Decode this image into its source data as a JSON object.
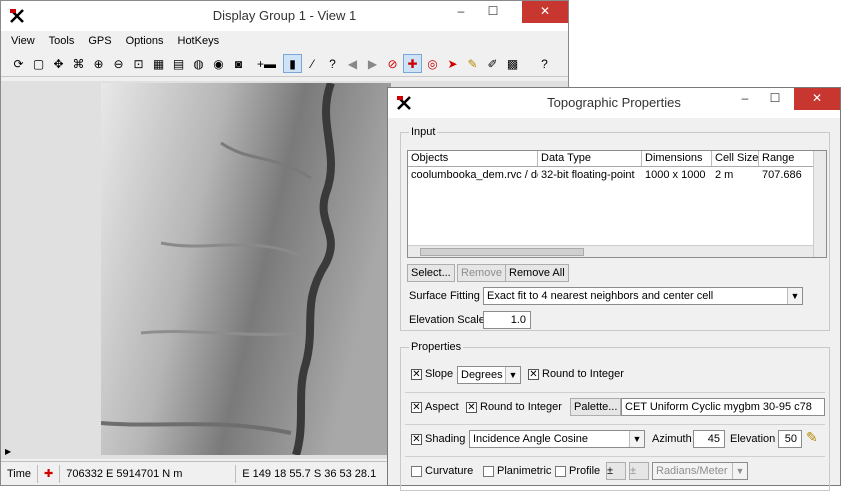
{
  "display_window": {
    "title": "Display Group 1 - View 1",
    "menu": [
      "View",
      "Tools",
      "GPS",
      "Options",
      "HotKeys"
    ],
    "toolbar_icons": [
      "redraw-icon",
      "full-view-icon",
      "pan-icon",
      "binoculars-icon",
      "zoom-in-icon",
      "zoom-out-icon",
      "zoom-box-icon",
      "grid-icon",
      "layer-icon",
      "globe-icon",
      "globe2-icon",
      "camera-icon",
      "add-layer-icon",
      "select-icon",
      "measure-icon",
      "help-cursor-icon",
      "back-icon",
      "forward-icon",
      "cancel-icon",
      "move-icon",
      "zoom-tool-icon",
      "select-arrow-icon",
      "sketch-icon",
      "edit-icon",
      "chart-icon",
      "help-icon"
    ],
    "controls": {
      "minimize": "–",
      "maximize": "☐",
      "close": "✕"
    },
    "status": {
      "time_label": "Time",
      "coords_en": "706332 E  5914701 N m",
      "coords_latlon": "E 149 18 55.7  S 36 53 28.1"
    }
  },
  "topo_window": {
    "title": "Topographic Properties",
    "controls": {
      "minimize": "–",
      "maximize": "☐",
      "close": "✕"
    },
    "input_group": {
      "legend": "Input",
      "columns": [
        "Objects",
        "Data Type",
        "Dimensions",
        "Cell Size",
        "Range"
      ],
      "rows": [
        {
          "object": "coolumbooka_dem.rvc / de",
          "data_type": "32-bit floating-point",
          "dimensions": "1000 x 1000",
          "cell_size": "2 m",
          "range": "707.686"
        }
      ],
      "select_button": "Select...",
      "remove_button": "Remove",
      "remove_all_button": "Remove All",
      "surface_fitting_label": "Surface Fitting",
      "surface_fitting_value": "Exact fit to 4 nearest neighbors and center cell",
      "elevation_scale_label": "Elevation Scale",
      "elevation_scale_value": "1.0"
    },
    "properties_group": {
      "legend": "Properties",
      "slope_label": "Slope",
      "slope_units": "Degrees",
      "round_label": "Round to Integer",
      "aspect_label": "Aspect",
      "aspect_round_label": "Round to Integer",
      "palette_button": "Palette...",
      "palette_value": "CET Uniform Cyclic mygbm 30-95 c78",
      "shading_label": "Shading",
      "shading_value": "Incidence Angle Cosine",
      "azimuth_label": "Azimuth",
      "azimuth_value": "45",
      "elevation_label": "Elevation",
      "elevation_value": "50",
      "curvature_label": "Curvature",
      "planimetric_label": "Planimetric",
      "profile_label": "Profile",
      "curvature_units": "Radians/Meter"
    }
  }
}
